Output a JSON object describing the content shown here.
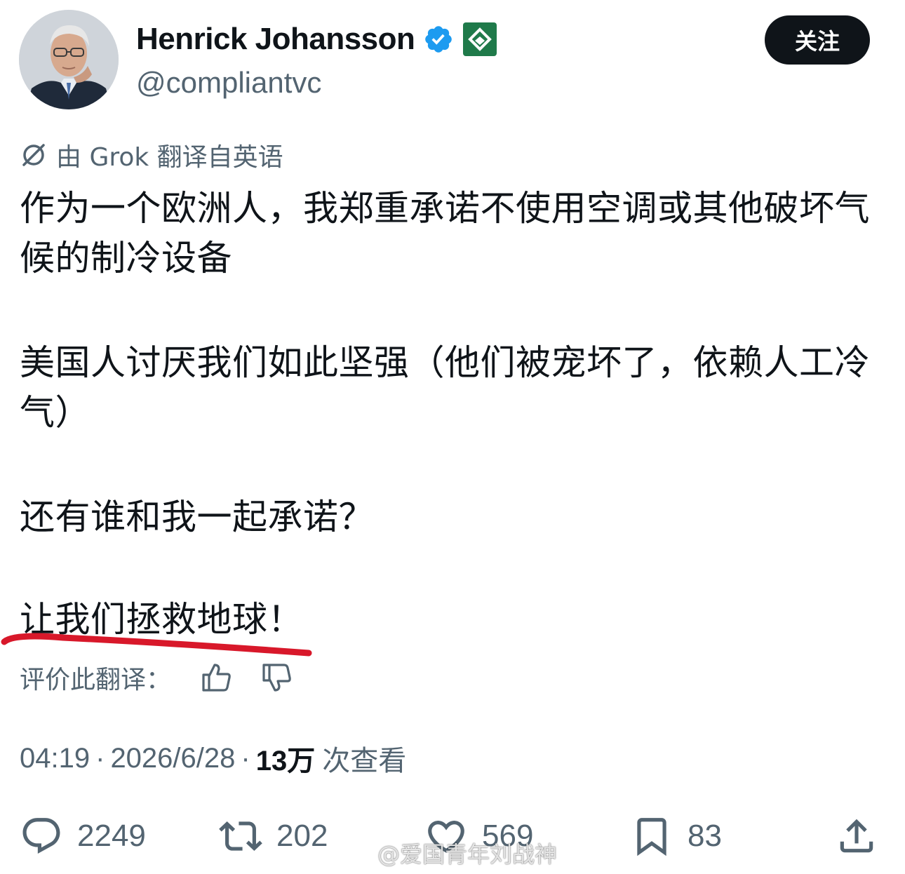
{
  "author": {
    "name": "Henrick Johansson",
    "handle": "@compliantvc",
    "verified": true,
    "follow_label": "关注"
  },
  "translation": {
    "label": "由 Grok 翻译自英语",
    "rate_label": "评价此翻译："
  },
  "tweet": {
    "paragraphs": [
      "作为一个欧洲人，我郑重承诺不使用空调或其他破坏气候的制冷设备",
      "美国人讨厌我们如此坚强（他们被宠坏了，依赖人工冷气）",
      "还有谁和我一起承诺？",
      "让我们拯救地球！"
    ]
  },
  "meta": {
    "time": "04:19",
    "date": "2026/6/28",
    "views_count": "13万",
    "views_label": "次查看"
  },
  "actions": {
    "replies": "2249",
    "retweets": "202",
    "likes": "569",
    "bookmarks": "83"
  },
  "watermark": {
    "text": "@爱国青年刘战神"
  },
  "colors": {
    "text_primary": "#0f1419",
    "text_secondary": "#536471",
    "verified_blue": "#1d9bf0",
    "affiliate_green": "#1f7a4a",
    "highlight_red": "#d8182a"
  }
}
